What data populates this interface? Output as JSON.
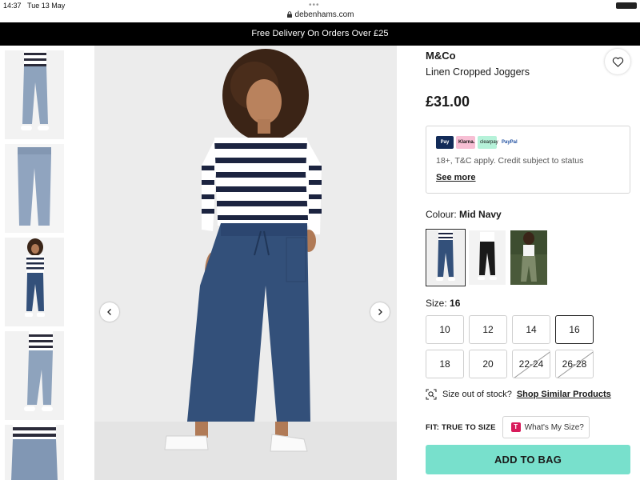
{
  "status": {
    "time": "14:37",
    "date": "Tue 13 May",
    "dots": "•••"
  },
  "browser": {
    "url": "debenhams.com"
  },
  "promo": {
    "text": "Free Delivery On Orders Over £25"
  },
  "product": {
    "brand": "M&Co",
    "name": "Linen Cropped Joggers",
    "price": "£31.00"
  },
  "credit": {
    "logos": [
      "Pay",
      "Klarna.",
      "clearpay",
      "PayPal"
    ],
    "text": "18+, T&C apply. Credit subject to status",
    "see_more": "See more"
  },
  "colour": {
    "label": "Colour:",
    "selected": "Mid Navy"
  },
  "size": {
    "label": "Size:",
    "selected": "16",
    "options": [
      {
        "label": "10",
        "state": "available"
      },
      {
        "label": "12",
        "state": "available"
      },
      {
        "label": "14",
        "state": "available"
      },
      {
        "label": "16",
        "state": "selected"
      },
      {
        "label": "18",
        "state": "available"
      },
      {
        "label": "20",
        "state": "available"
      },
      {
        "label": "22-24",
        "state": "out-of-stock"
      },
      {
        "label": "26-28",
        "state": "out-of-stock"
      }
    ]
  },
  "stock": {
    "question": "Size out of stock?",
    "link": "Shop Similar Products"
  },
  "fit": {
    "label": "FIT: TRUE TO SIZE",
    "button": "What's My Size?",
    "logo": "T"
  },
  "cta": {
    "add_to_bag": "ADD TO BAG"
  },
  "icons": {
    "wishlist": "heart-icon",
    "prev": "chevron-left-icon",
    "next": "chevron-right-icon",
    "search": "image-search-icon",
    "lock": "lock-icon"
  },
  "colors": {
    "accent": "#78e0cc",
    "banner": "#000000",
    "trouser": "#33507a"
  }
}
